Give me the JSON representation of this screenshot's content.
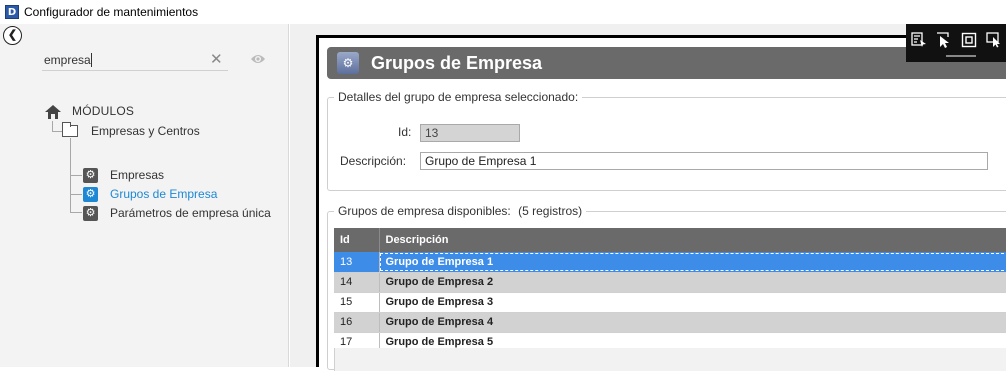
{
  "window": {
    "title": "Configurador de mantenimientos",
    "app_icon_letter": "D"
  },
  "sidebar": {
    "search": {
      "value": "empresa",
      "placeholder": ""
    },
    "tree": {
      "root": "MÓDULOS",
      "folder": "Empresas y Centros",
      "items": [
        {
          "label": "Empresas",
          "selected": false
        },
        {
          "label": "Grupos de Empresa",
          "selected": true
        },
        {
          "label": "Parámetros de empresa única",
          "selected": false
        }
      ]
    }
  },
  "main": {
    "title": "Grupos de Empresa",
    "details": {
      "legend": "Detalles del grupo de empresa seleccionado:",
      "id_label": "Id:",
      "id_value": "13",
      "desc_label": "Descripción:",
      "desc_value": "Grupo de Empresa 1"
    },
    "list": {
      "legend": "Grupos de empresa disponibles:",
      "count_text": "(5 registros)",
      "columns": [
        "Id",
        "Descripción"
      ],
      "rows": [
        {
          "id": "13",
          "desc": "Grupo de Empresa 1"
        },
        {
          "id": "14",
          "desc": "Grupo de Empresa 2"
        },
        {
          "id": "15",
          "desc": "Grupo de Empresa 3"
        },
        {
          "id": "16",
          "desc": "Grupo de Empresa 4"
        },
        {
          "id": "17",
          "desc": "Grupo de Empresa 5"
        }
      ],
      "selected_id": "13"
    }
  },
  "toolbar": {
    "icons": [
      "select-element-icon",
      "pointer-select-icon",
      "focus-frame-icon",
      "cursor-window-icon"
    ]
  },
  "colors": {
    "selection": "#3c8ce8",
    "tree_selected": "#1e88d4",
    "header_bg": "#6a6a6a"
  }
}
